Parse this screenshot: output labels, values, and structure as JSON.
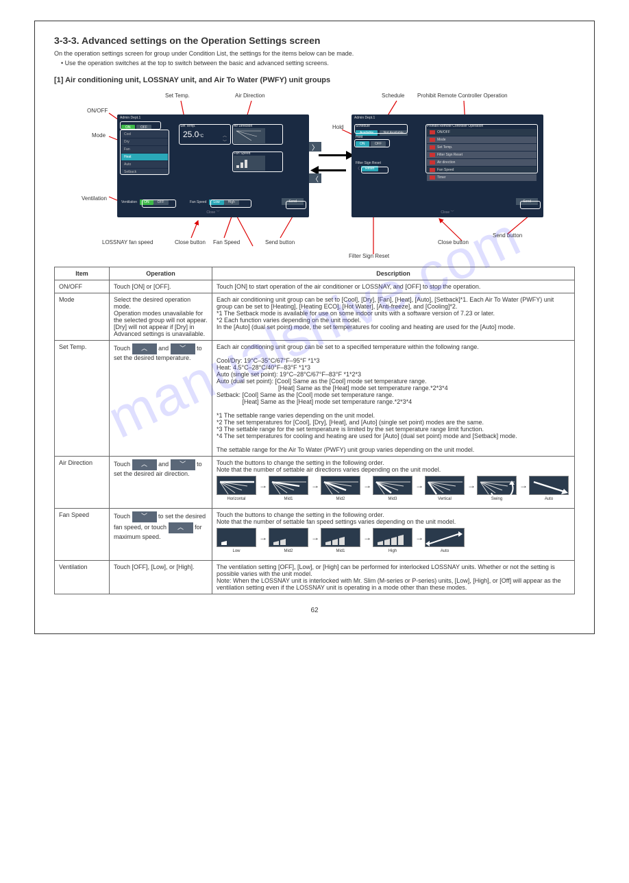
{
  "section": {
    "number": "3-3-3.",
    "title": "Advanced settings on the Operation Settings screen",
    "desc": "On the operation settings screen for group under Condition List, the settings for the items below can be made.",
    "note": "• Use the operation switches at the top to switch between the basic and advanced setting screens."
  },
  "subsection": {
    "number": "[1]",
    "title": "Air conditioning unit, LOSSNAY unit, and Air To Water (PWFY) unit groups"
  },
  "panel_left": {
    "title": "Admin Dept.1",
    "on": "ON",
    "off": "OFF",
    "modes": [
      "Cool",
      "Dry",
      "Fan",
      "Heat",
      "Auto",
      "Setback"
    ],
    "active_mode": "Heat",
    "set_temp_label": "Set Temp.",
    "set_temp_val": "25.0",
    "set_temp_unit": "°C",
    "air_dir_label": "Air Direction",
    "fan_spd_label": "Fan Speed",
    "ventilation": "Ventilation",
    "vent_on": "ON",
    "vent_off": "OFF",
    "fan_speed": "Fan Speed",
    "fs_low": "Low",
    "fs_high": "High",
    "close": "Close",
    "send": "Send"
  },
  "panel_right": {
    "title": "Admin Dept.1",
    "sched_label": "Schedule",
    "sched_avail": "Available",
    "sched_notavail": "Not Available",
    "hold": "Hold",
    "hold_on": "ON",
    "hold_off": "OFF",
    "filter": "Filter Sign Reset",
    "filter_reset": "Reset",
    "prohibit_title": "Prohibit Remote Controller Operation",
    "items": [
      "ON/OFF",
      "Mode",
      "Set Temp.",
      "Filter Sign Reset",
      "Air direction",
      "Fan Speed",
      "Timer"
    ],
    "close": "Close",
    "send": "Send"
  },
  "labels": {
    "l1": "ON/OFF",
    "l2": "Mode",
    "l3": "Set Temp.",
    "l4": "Air Direction",
    "l4b": "LOSSNAY fan speed",
    "l5": "Fan Speed",
    "l6": "Ventilation",
    "l7": "Close button",
    "l8": "Send button",
    "r1": "Schedule",
    "r2": "Prohibit Remote Controller Operation",
    "r3": "Hold",
    "r4": "Filter Sign Reset",
    "r5": "Close button",
    "r6": "Send button"
  },
  "table": {
    "headers": [
      "Item",
      "Operation",
      "Description"
    ],
    "rows": [
      {
        "item": "ON/OFF",
        "op": "Touch [ON] or [OFF].",
        "desc": "Touch [ON] to start operation of the air conditioner or LOSSNAY, and [OFF] to stop the operation."
      },
      {
        "item": "Mode",
        "op": "Select the desired operation mode.\nOperation modes unavailable for the selected group will not appear. [Dry] will not appear if [Dry] in Advanced settings is unavailable.",
        "desc": "Each air conditioning unit group can be set to [Cool], [Dry], [Fan], [Heat], [Auto], [Setback]*1. Each Air To Water (PWFY) unit group can be set to [Heating], [Heating ECO], [Hot Water], [Anti-freeze], and [Cooling]*2.\n*1 The Setback mode is available for use on some indoor units with a software version of 7.23 or later.\n*2 Each function varies depending on the unit model.\nIn the [Auto] (dual set point) mode, the set temperatures for cooling and heating are used for the [Auto] mode."
      },
      {
        "item": "Set Temp.",
        "op_parts": [
          "Touch",
          " and ",
          " to set the desired temperature."
        ],
        "desc": "Each air conditioning unit group can be set to a specified temperature within the following range.\n\nCool/Dry: 19°C–35°C/67°F–95°F *1*3\nHeat: 4.5°C–28°C/40°F–83°F *1*3\nAuto (single set point): 19°C–28°C/67°F–83°F *1*2*3\nAuto (dual set point): [Cool] Same as the [Cool] mode set temperature range.\n                                    [Heat] Same as the [Heat] mode set temperature range.*2*3*4\nSetback: [Cool] Same as the [Cool] mode set temperature range.\n               [Heat] Same as the [Heat] mode set temperature range.*2*3*4\n\n*1 The settable range varies depending on the unit model.\n*2 The set temperatures for [Cool], [Dry], [Heat], and [Auto] (single set point) modes are the same.\n*3 The settable range for the set temperature is limited by the set temperature range limit function.\n*4 The set temperatures for cooling and heating are used for [Auto] (dual set point) mode and [Setback] mode.\n\nThe settable range for the Air To Water (PWFY) unit group varies depending on the unit model."
      },
      {
        "item": "Air Direction",
        "op_parts": [
          "Touch",
          " and ",
          " to set the desired air direction."
        ],
        "desc": "Touch the buttons to change the setting in the following order.\nNote that the number of settable air directions varies depending on the unit model.",
        "seq_labels": [
          "Horizontal",
          "Mid1",
          "Mid2",
          "Mid3",
          "Vertical",
          "Swing",
          "Auto"
        ]
      },
      {
        "item": "Fan Speed",
        "op_parts": [
          "Touch ",
          " to set the desired fan speed, or touch ",
          " for maximum speed."
        ],
        "desc": "Touch the buttons to change the setting in the following order.\nNote that the number of settable fan speed settings varies depending on the unit model.",
        "seq_labels": [
          "Low",
          "Mid2",
          "Mid1",
          "High",
          "Auto"
        ]
      },
      {
        "item": "Ventilation",
        "op": "Touch [OFF], [Low], or [High].",
        "desc": "The ventilation setting [OFF], [Low], or [High] can be performed for interlocked LOSSNAY units. Whether or not the setting is possible varies with the unit model.\nNote: When the LOSSNAY unit is interlocked with Mr. Slim (M-series or P-series) units, [Low], [High], or [Off] will appear as the ventilation setting even if the LOSSNAY unit is operating in a mode other than these modes."
      }
    ]
  },
  "page_number": "62"
}
